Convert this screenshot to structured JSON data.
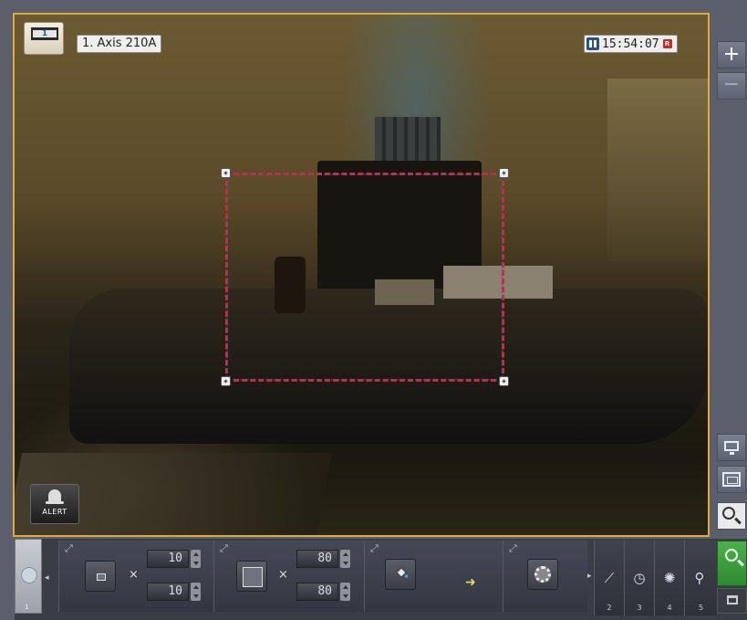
{
  "camera": {
    "number_icon_text": "1",
    "label": "1. Axis 210A",
    "time": "15:54:07",
    "rec_indicator": "R"
  },
  "alert": {
    "label": "ALERT"
  },
  "side": {
    "zoom_in": "+",
    "zoom_out": "−"
  },
  "toolbar": {
    "min_size": {
      "width": "10",
      "height": "10"
    },
    "max_size": {
      "width": "80",
      "height": "80"
    },
    "times_sign": "×",
    "tabs": [
      {
        "num": "2"
      },
      {
        "num": "3"
      },
      {
        "num": "4"
      },
      {
        "num": "5"
      }
    ],
    "left_tab_num": "1"
  },
  "colors": {
    "frame_border": "#e0a93a",
    "zone_dash": "#d42a2a",
    "search_green": "#3ea23e"
  }
}
